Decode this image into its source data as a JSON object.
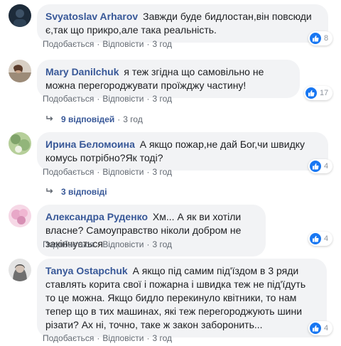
{
  "actions": {
    "like_label": "Подобається",
    "reply_label": "Відповісти",
    "separator": "·"
  },
  "comments": [
    {
      "author": "Svyatoslav Arharov",
      "text": "Завжди буде бидлостан,він повсюди є,так що прикро,але така реальність.",
      "time": "3 год",
      "reactions": "8",
      "avatar_color": "#1d2b3a"
    },
    {
      "author": "Mary Danilchuk",
      "text": "я теж згідна що самовільно не можна перегороджувати проїжджу частину!",
      "time": "3 год",
      "reactions": "17",
      "avatar_color": "#b8a89a",
      "replies_label": "9 відповідей",
      "replies_time": "3 год"
    },
    {
      "author": "Ирина Беломоина",
      "text": "А якщо пожар,не дай Бог,чи швидку комусь потрібно?Як тоді?",
      "time": "3 год",
      "reactions": "4",
      "avatar_color": "#7fa36a",
      "replies_label": "3 відповіді"
    },
    {
      "author": "Александра Руденко",
      "text": "Хм... А як ви хотіли власне? Самоуправство ніколи добром не закінчується",
      "time": "3 год",
      "reactions": "4",
      "avatar_color": "#e8a8c8"
    },
    {
      "author": "Tanya Ostapchuk",
      "text": "А якщо під самим під'їздом в 3 ряди ставлять корита свої і пожарна і швидка теж не під'їдуть то це можна. Якщо бидло перекинуло квітники, то нам тепер що в тих машинах, які теж перегороджують шини різати? Ах ні, точно, таке ж закон заборонить...",
      "time": "3 год",
      "reactions": "4",
      "avatar_color": "#c9c9c9"
    }
  ],
  "colors": {
    "link": "#385898",
    "bubble": "#f2f3f5",
    "like": "#1877f2",
    "meta": "#606770"
  }
}
